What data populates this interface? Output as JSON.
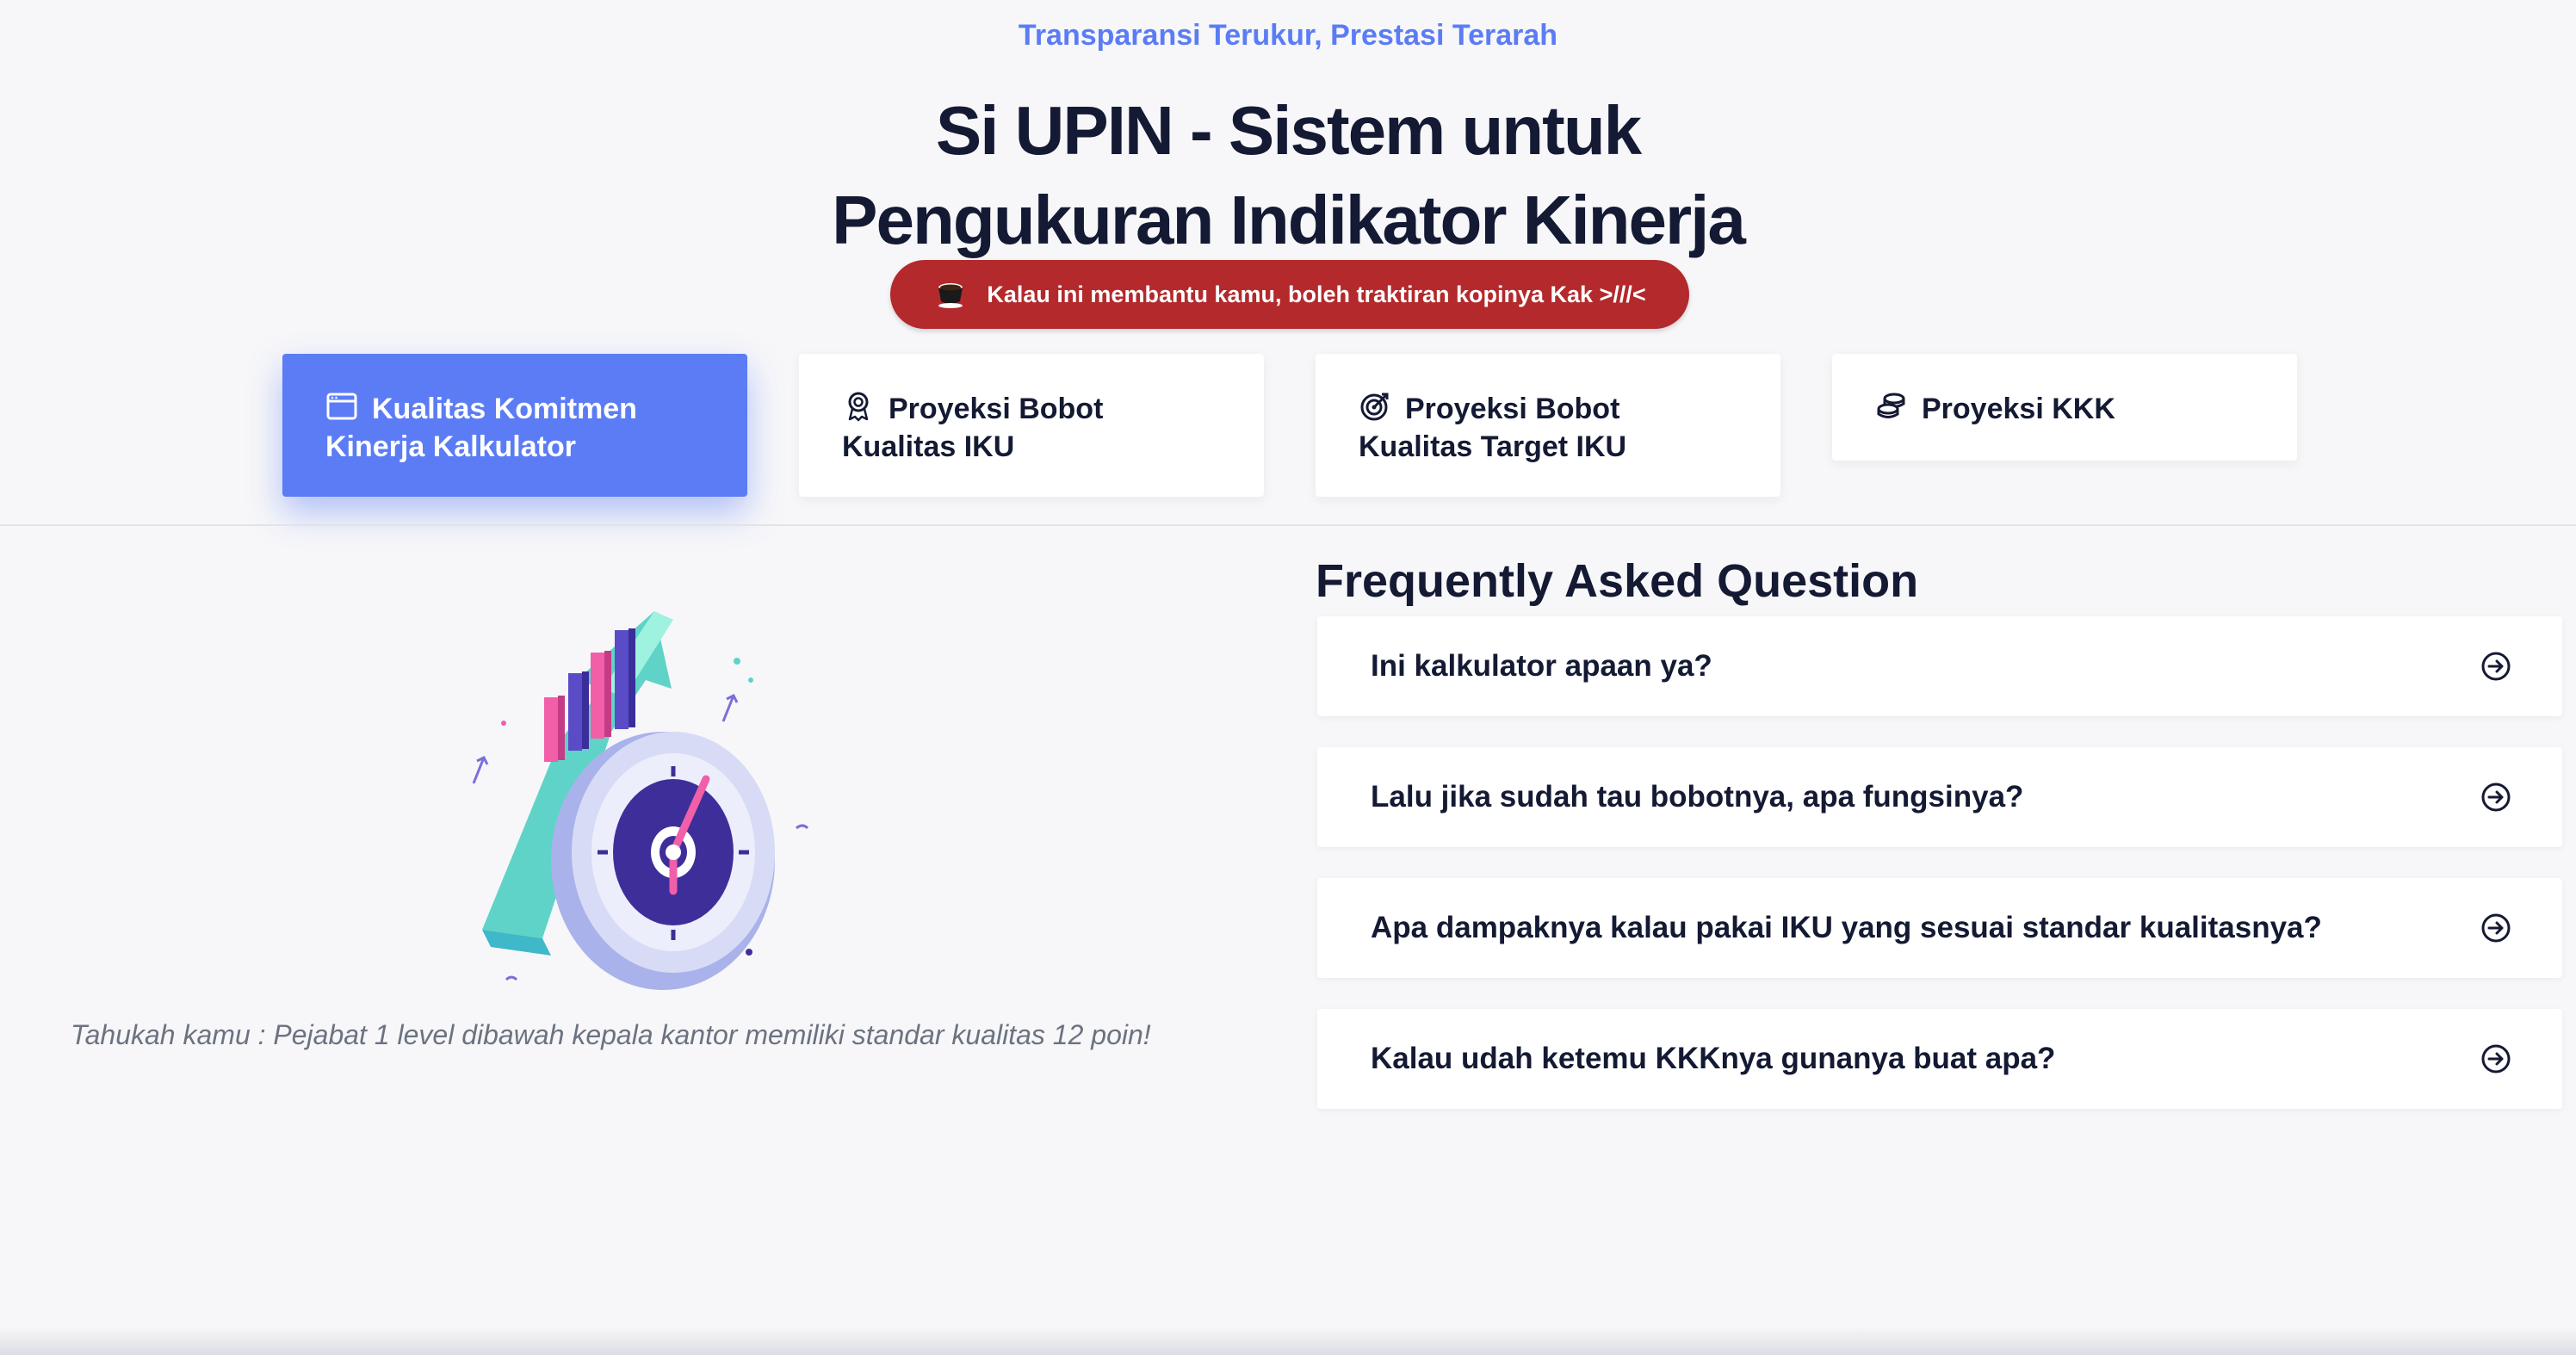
{
  "hero": {
    "tagline": "Transparansi Terukur, Prestasi Terarah",
    "title_line1": "Si UPIN - Sistem untuk",
    "title_line2": "Pengukuran Indikator Kinerja"
  },
  "donation": {
    "label": "Kalau ini membantu kamu, boleh traktiran kopinya Kak >///<",
    "icon": "coffee-cup-icon"
  },
  "tabs": [
    {
      "label": "Kualitas Komitmen Kinerja Kalkulator",
      "icon": "calendar-window-icon",
      "active": true
    },
    {
      "label": "Proyeksi Bobot Kualitas IKU",
      "icon": "award-badge-icon",
      "active": false
    },
    {
      "label": "Proyeksi Bobot Kualitas Target IKU",
      "icon": "target-icon",
      "active": false
    },
    {
      "label": "Proyeksi KKK",
      "icon": "coins-icon",
      "active": false
    }
  ],
  "fun_fact": "Tahukah kamu : Pejabat 1 level dibawah kepala kantor memiliki standar kualitas 12 poin!",
  "faq": {
    "title": "Frequently Asked Question",
    "items": [
      {
        "question": "Ini kalkulator apaan ya?"
      },
      {
        "question": "Lalu jika sudah tau bobotnya, apa fungsinya?"
      },
      {
        "question": "Apa dampaknya kalau pakai IKU yang sesuai standar kualitasnya?"
      },
      {
        "question": "Kalau udah ketemu KKKnya gunanya buat apa?"
      }
    ],
    "expand_icon": "arrow-right-circle-icon"
  },
  "colors": {
    "accent": "#5b7cf5",
    "donation_red": "#b3292c",
    "text_dark": "#141a33",
    "background": "#f7f7f9"
  }
}
